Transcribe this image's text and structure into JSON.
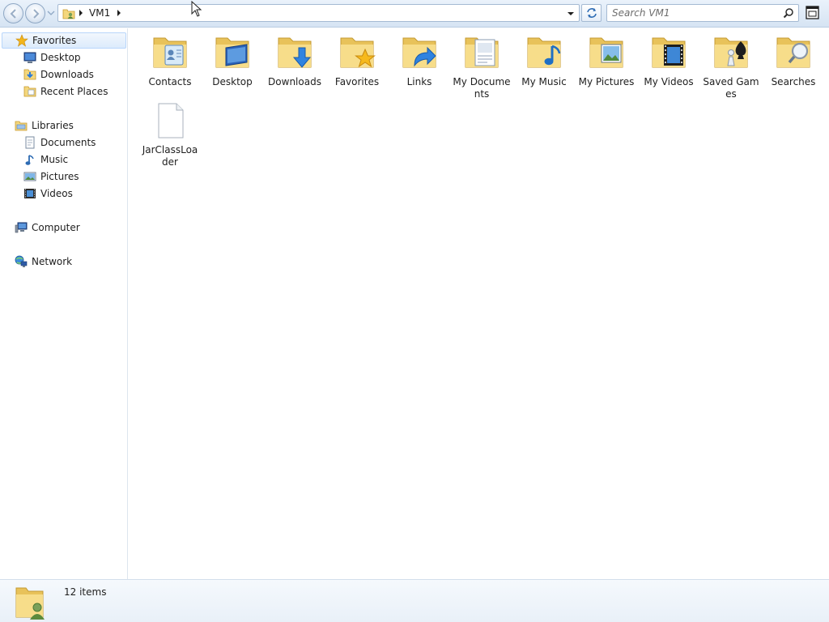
{
  "address": {
    "breadcrumb": [
      "VM1"
    ],
    "dropdown_icon": "chevron-down-icon"
  },
  "search": {
    "placeholder": "Search VM1"
  },
  "sidebar": {
    "favorites": {
      "label": "Favorites",
      "items": [
        {
          "label": "Desktop",
          "icon": "desktop-icon"
        },
        {
          "label": "Downloads",
          "icon": "downloads-icon"
        },
        {
          "label": "Recent Places",
          "icon": "recent-places-icon"
        }
      ]
    },
    "libraries": {
      "label": "Libraries",
      "items": [
        {
          "label": "Documents",
          "icon": "documents-icon"
        },
        {
          "label": "Music",
          "icon": "music-icon"
        },
        {
          "label": "Pictures",
          "icon": "pictures-icon"
        },
        {
          "label": "Videos",
          "icon": "videos-icon"
        }
      ]
    },
    "computer": {
      "label": "Computer"
    },
    "network": {
      "label": "Network"
    }
  },
  "files": [
    {
      "label": "Contacts",
      "icon": "contacts-folder-icon"
    },
    {
      "label": "Desktop",
      "icon": "desktop-folder-icon"
    },
    {
      "label": "Downloads",
      "icon": "downloads-folder-icon"
    },
    {
      "label": "Favorites",
      "icon": "favorites-folder-icon"
    },
    {
      "label": "Links",
      "icon": "links-folder-icon"
    },
    {
      "label": "My Documents",
      "icon": "documents-folder-icon"
    },
    {
      "label": "My Music",
      "icon": "music-folder-icon"
    },
    {
      "label": "My Pictures",
      "icon": "pictures-folder-icon"
    },
    {
      "label": "My Videos",
      "icon": "videos-folder-icon"
    },
    {
      "label": "Saved Games",
      "icon": "saved-games-folder-icon"
    },
    {
      "label": "Searches",
      "icon": "searches-folder-icon"
    },
    {
      "label": "JarClassLoader",
      "icon": "file-icon"
    }
  ],
  "status": {
    "item_count": "12 items"
  },
  "colors": {
    "folder": "#f4d77c",
    "folder_dark": "#d9a93b",
    "selection": "#dcebfc",
    "topbar": "#d6e4f3"
  }
}
